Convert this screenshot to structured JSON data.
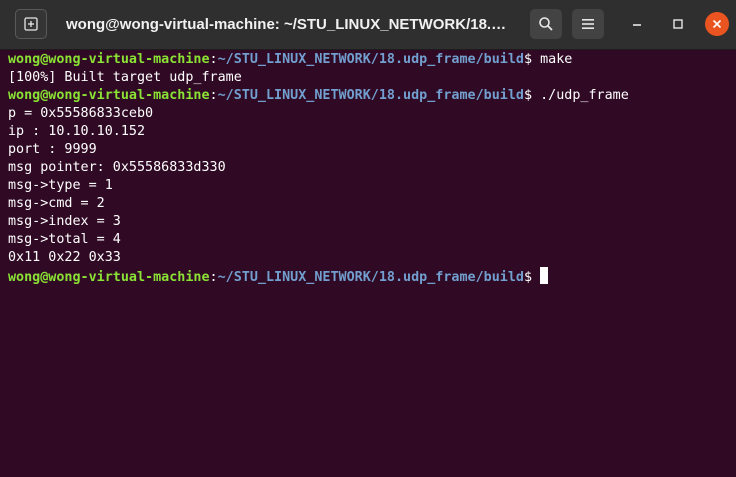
{
  "window": {
    "title": "wong@wong-virtual-machine: ~/STU_LINUX_NETWORK/18.u..."
  },
  "icons": {
    "new_tab": "new-tab-icon",
    "search": "search-icon",
    "menu": "hamburger-menu-icon",
    "minimize": "minimize-icon",
    "maximize": "maximize-icon",
    "close": "close-icon"
  },
  "colors": {
    "terminal_bg": "#300a24",
    "prompt_user": "#8ae234",
    "prompt_path": "#729fcf",
    "close_accent": "#e95420"
  },
  "terminal": {
    "prompt_user": "wong@wong-virtual-machine",
    "prompt_colon": ":",
    "prompt_path": "~/STU_LINUX_NETWORK/18.udp_frame/build",
    "prompt_symbol": "$",
    "cmd1": " make",
    "out1": "[100%] Built target udp_frame",
    "cmd2": " ./udp_frame",
    "out2": "p = 0x55586833ceb0",
    "out3": "ip : 10.10.10.152",
    "out4": "port : 9999",
    "out5": "msg pointer: 0x55586833d330",
    "out6": "msg->type = 1",
    "out7": "msg->cmd = 2",
    "out8": "msg->index = 3",
    "out9": "msg->total = 4",
    "out10": "0x11 0x22 0x33",
    "cmd3": " "
  }
}
